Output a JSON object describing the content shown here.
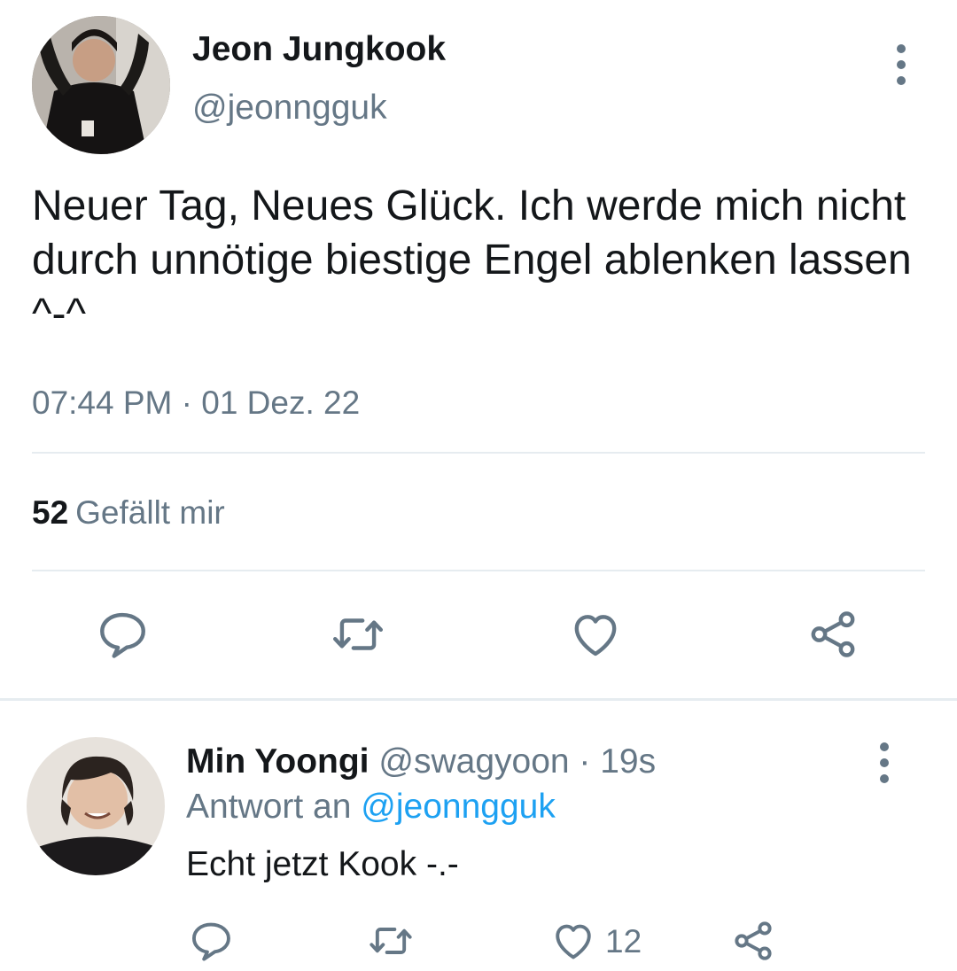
{
  "tweet": {
    "author_name": "Jeon Jungkook",
    "author_handle": "@jeonngguk",
    "text": "Neuer Tag, Neues Glück. Ich werde mich nicht durch unnötige biestige Engel ablenken lassen ^-^",
    "timestamp": "07:44 PM · 01 Dez. 22",
    "likes_count": "52",
    "likes_label": "Gefällt mir",
    "actions": [
      "reply-icon",
      "retweet-icon",
      "like-icon",
      "share-icon"
    ]
  },
  "reply": {
    "author_name": "Min Yoongi",
    "meta": "@swagyoon · 19s",
    "reply_to_label": "Antwort an",
    "reply_to_handle": "@jeonngguk",
    "text": "Echt jetzt Kook -.-",
    "like_count": "12",
    "actions": [
      "reply-icon",
      "retweet-icon",
      "like-icon",
      "share-icon"
    ]
  },
  "colors": {
    "text_primary": "#14171a",
    "text_secondary": "#657786",
    "link": "#1da1f2",
    "divider": "#e6ecf0"
  }
}
